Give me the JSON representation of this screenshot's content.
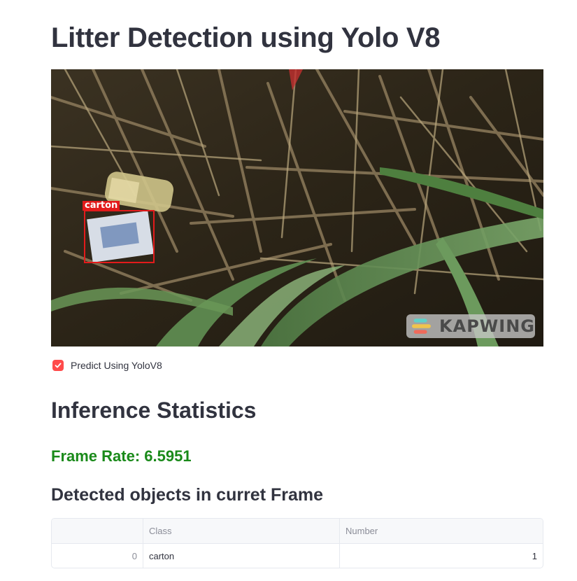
{
  "page": {
    "title": "Litter Detection using Yolo V8"
  },
  "video": {
    "detection_label": "carton",
    "watermark_text": "KAPWING",
    "box_color": "#e31b1b"
  },
  "checkbox": {
    "label": "Predict Using YoloV8",
    "checked": true,
    "color": "#ff4b4b"
  },
  "stats": {
    "heading": "Inference Statistics",
    "frame_rate_text": "Frame Rate: 6.5951",
    "frame_rate_color": "#1a8a1a",
    "objects_heading": "Detected objects in curret Frame"
  },
  "table": {
    "columns": [
      "",
      "Class",
      "Number"
    ],
    "rows": [
      {
        "index": "0",
        "class": "carton",
        "number": "1"
      }
    ]
  }
}
